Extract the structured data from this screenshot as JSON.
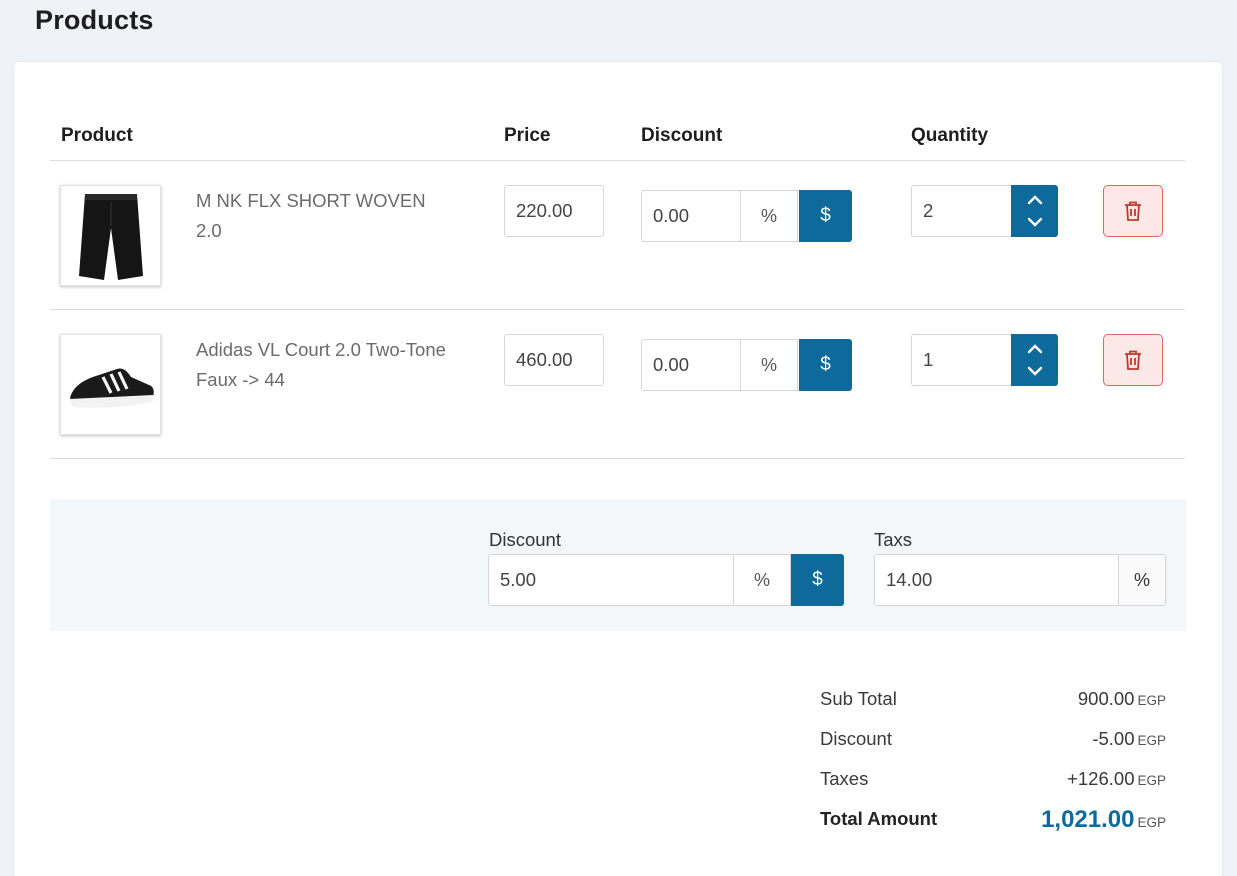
{
  "page": {
    "title": "Products"
  },
  "table": {
    "headers": {
      "product": "Product",
      "price": "Price",
      "discount": "Discount",
      "quantity": "Quantity"
    },
    "rows": [
      {
        "name": "M NK FLX SHORT WOVEN 2.0",
        "image": "black-shorts",
        "price": "220.00",
        "discount": "0.00",
        "discount_pct": "%",
        "discount_fixed": "$",
        "quantity": "2"
      },
      {
        "name": "Adidas VL Court 2.0 Two-Tone Faux -> 44",
        "image": "black-sneaker",
        "price": "460.00",
        "discount": "0.00",
        "discount_pct": "%",
        "discount_fixed": "$",
        "quantity": "1"
      }
    ]
  },
  "adjustments": {
    "discount_label": "Discount",
    "discount_value": "5.00",
    "discount_pct": "%",
    "discount_fixed": "$",
    "taxes_label": "Taxs",
    "taxes_value": "14.00",
    "taxes_pct": "%"
  },
  "summary": {
    "currency": "EGP",
    "subtotal_label": "Sub Total",
    "subtotal_value": "900.00",
    "discount_label": "Discount",
    "discount_value": "-5.00",
    "taxes_label": "Taxes",
    "taxes_value": "+126.00",
    "total_label": "Total Amount",
    "total_value": "1,021.00"
  },
  "colors": {
    "accent": "#0e6a9a",
    "danger": "#d9534f",
    "danger_bg": "#fde8e8",
    "page_bg": "#eff3f7",
    "panel_bg": "#f3f7f9"
  }
}
